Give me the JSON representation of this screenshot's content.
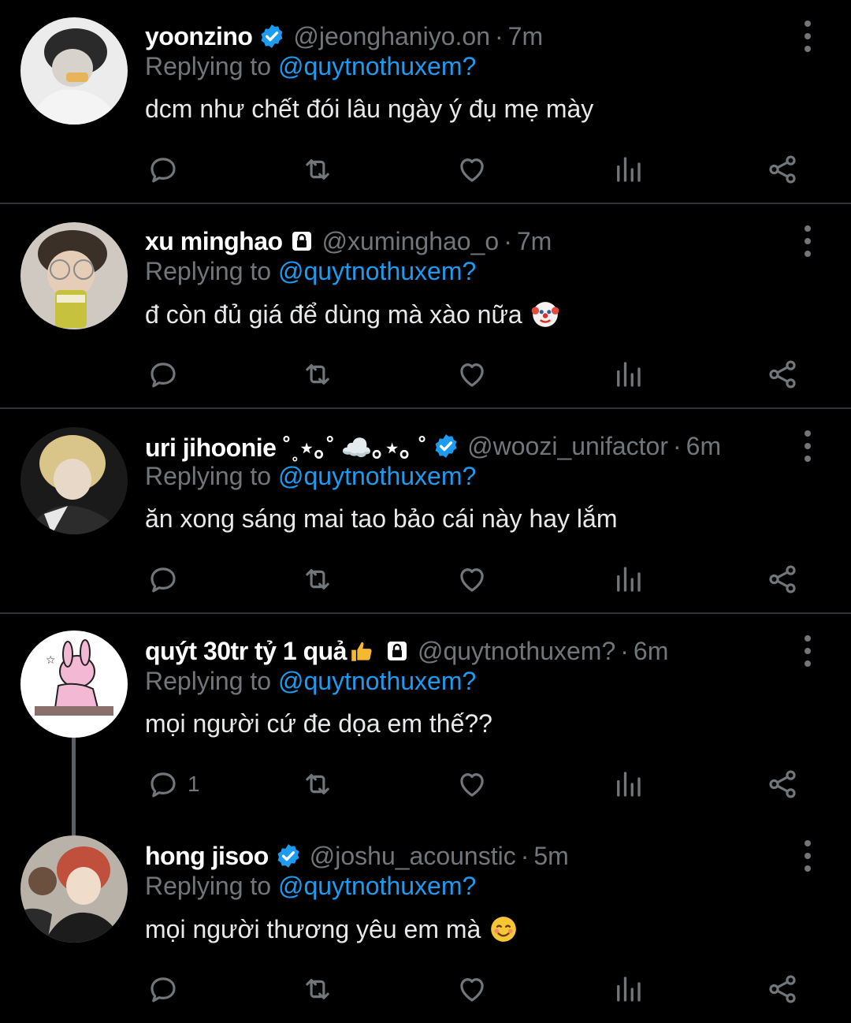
{
  "colors": {
    "background": "#000000",
    "divider": "#2f3336",
    "muted": "#71767b",
    "mention": "#1d9bf0",
    "verified": "#1d9bf0",
    "text": "#e7e9ea"
  },
  "replying_prefix": "Replying to",
  "replies": [
    {
      "name": "yoonzino",
      "badge": "verified-badge-icon",
      "handle": "@jeonghaniyo.on",
      "time": "7m",
      "replying_to": "@quytnothuxem?",
      "text": "dcm như chết đói lâu ngày ý đụ mẹ mày",
      "emoji": "",
      "reply_count": ""
    },
    {
      "name": "xu minghao",
      "badge": "lock-icon",
      "handle": "@xuminghao_o",
      "time": "7m",
      "replying_to": "@quytnothuxem?",
      "text": "đ còn đủ giá để dùng mà xào nữa",
      "emoji": "clown-face-icon",
      "reply_count": ""
    },
    {
      "name": "uri jihoonie ˚˳⋆｡˚ ☁️｡⋆｡ ˚",
      "badge": "verified-badge-icon",
      "handle": "@woozi_unifactor",
      "time": "6m",
      "replying_to": "@quytnothuxem?",
      "text": "ăn xong sáng mai tao bảo cái này hay lắm",
      "emoji": "",
      "reply_count": ""
    },
    {
      "name": "quýt 30tr tỷ 1 quả",
      "badge": "thumbs-up-and-lock-icon",
      "handle": "@quytnothuxem?",
      "time": "6m",
      "replying_to": "@quytnothuxem?",
      "text": "mọi người cứ đe dọa em thế??",
      "emoji": "",
      "reply_count": "1"
    },
    {
      "name": "hong jisoo",
      "badge": "verified-badge-icon",
      "handle": "@joshu_acounstic",
      "time": "5m",
      "replying_to": "@quytnothuxem?",
      "text": "mọi người thương yêu em mà",
      "emoji": "smiling-face-icon",
      "reply_count": ""
    }
  ]
}
